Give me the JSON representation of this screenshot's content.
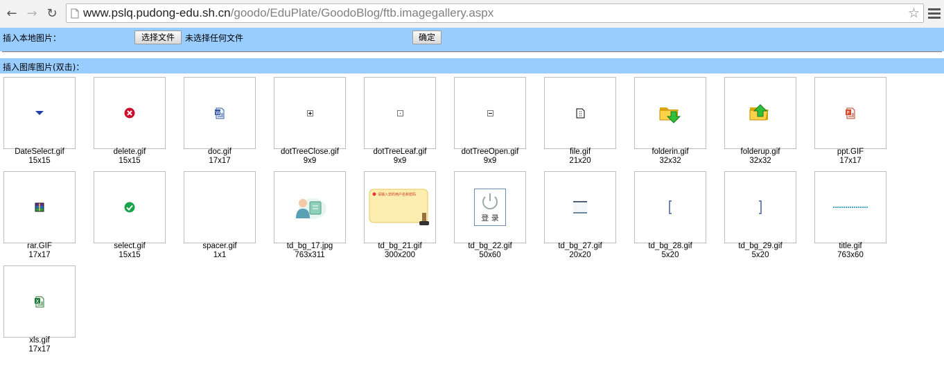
{
  "browser": {
    "url_host": "www.pslq.pudong-edu.sh.cn",
    "url_path": "/goodo/EduPlate/GoodoBlog/ftb.imagegallery.aspx"
  },
  "upload": {
    "label": "插入本地图片：",
    "choose_button": "选择文件",
    "no_file_text": "未选择任何文件",
    "confirm_button": "确定"
  },
  "gallery": {
    "label": "插入图库图片(双击)：",
    "items": [
      {
        "name": "DateSelect.gif",
        "size": "15x15",
        "icon": "dropdown-arrow-icon"
      },
      {
        "name": "delete.gif",
        "size": "15x15",
        "icon": "delete-icon"
      },
      {
        "name": "doc.gif",
        "size": "17x17",
        "icon": "word-doc-icon"
      },
      {
        "name": "dotTreeClose.gif",
        "size": "9x9",
        "icon": "tree-plus-icon"
      },
      {
        "name": "dotTreeLeaf.gif",
        "size": "9x9",
        "icon": "tree-leaf-icon"
      },
      {
        "name": "dotTreeOpen.gif",
        "size": "9x9",
        "icon": "tree-minus-icon"
      },
      {
        "name": "file.gif",
        "size": "21x20",
        "icon": "file-icon"
      },
      {
        "name": "folderin.gif",
        "size": "32x32",
        "icon": "folder-in-icon"
      },
      {
        "name": "folderup.gif",
        "size": "32x32",
        "icon": "folder-up-icon"
      },
      {
        "name": "ppt.GIF",
        "size": "17x17",
        "icon": "ppt-icon"
      },
      {
        "name": "rar.GIF",
        "size": "17x17",
        "icon": "rar-icon"
      },
      {
        "name": "select.gif",
        "size": "15x15",
        "icon": "check-icon"
      },
      {
        "name": "spacer.gif",
        "size": "1x1",
        "icon": "spacer-blank"
      },
      {
        "name": "td_bg_17.jpg",
        "size": "763x311",
        "icon": "user-illustration-icon"
      },
      {
        "name": "td_bg_21.gif",
        "size": "300x200",
        "icon": "note-card-icon",
        "card_text": "请输入您的用户名和密码"
      },
      {
        "name": "td_bg_22.gif",
        "size": "50x60",
        "icon": "power-login-icon",
        "login_text": "登 录"
      },
      {
        "name": "td_bg_27.gif",
        "size": "20x20",
        "icon": "line-bar-icon"
      },
      {
        "name": "td_bg_28.gif",
        "size": "5x20",
        "icon": "left-bracket-icon"
      },
      {
        "name": "td_bg_29.gif",
        "size": "5x20",
        "icon": "right-bracket-icon"
      },
      {
        "name": "title.gif",
        "size": "763x60",
        "icon": "title-strip-icon"
      },
      {
        "name": "xls.gif",
        "size": "17x17",
        "icon": "excel-icon"
      }
    ]
  }
}
